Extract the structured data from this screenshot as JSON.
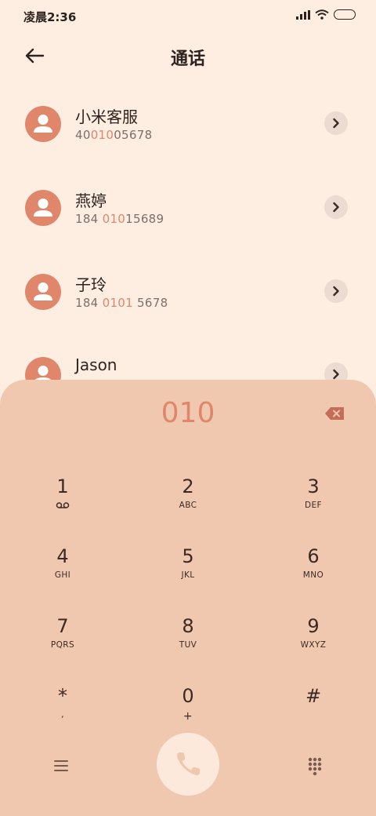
{
  "status_bar": {
    "time": "凌晨2:36"
  },
  "header": {
    "title": "通话"
  },
  "contacts": [
    {
      "name": "小米客服",
      "number_pre": "40",
      "number_hl": "010",
      "number_post": "05678"
    },
    {
      "name": "燕婷",
      "number_pre": "184 ",
      "number_hl": "010",
      "number_post": "15689"
    },
    {
      "name": "子玲",
      "number_pre": "184 ",
      "number_hl": "0101",
      "number_post": " 5678"
    },
    {
      "name": "Jason",
      "number_pre": "",
      "number_hl": "",
      "number_post": ""
    }
  ],
  "dialer": {
    "input": "010",
    "keys": [
      {
        "digit": "1",
        "letters": ""
      },
      {
        "digit": "2",
        "letters": "ABC"
      },
      {
        "digit": "3",
        "letters": "DEF"
      },
      {
        "digit": "4",
        "letters": "GHI"
      },
      {
        "digit": "5",
        "letters": "JKL"
      },
      {
        "digit": "6",
        "letters": "MNO"
      },
      {
        "digit": "7",
        "letters": "PQRS"
      },
      {
        "digit": "8",
        "letters": "TUV"
      },
      {
        "digit": "9",
        "letters": "WXYZ"
      },
      {
        "digit": "*",
        "letters": ","
      },
      {
        "digit": "0",
        "letters": "+"
      },
      {
        "digit": "#",
        "letters": ""
      }
    ]
  },
  "icons": {
    "back": "arrow-left-icon",
    "detail": "chevron-right-icon",
    "backspace": "backspace-icon",
    "voicemail": "voicemail-icon",
    "menu": "menu-icon",
    "call": "phone-icon",
    "keypad": "dialpad-icon"
  },
  "colors": {
    "background": "#fdeee1",
    "dialer": "#f0c8b0",
    "accent": "#e0866a",
    "call_button": "#fde9db"
  }
}
